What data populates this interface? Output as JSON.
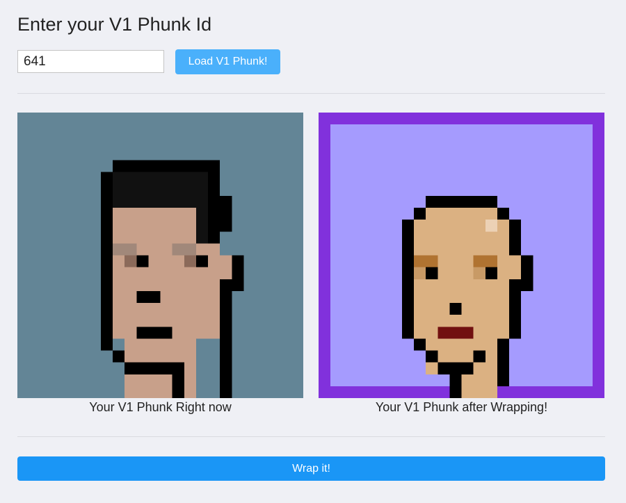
{
  "page": {
    "heading": "Enter your V1 Phunk Id"
  },
  "form": {
    "phunk_id_value": "641",
    "load_button_label": "Load V1 Phunk!"
  },
  "preview": {
    "current_caption": "Your V1 Phunk Right now",
    "wrapped_caption": "Your V1 Phunk after Wrapping!"
  },
  "actions": {
    "wrap_button_label": "Wrap it!"
  },
  "colors": {
    "current_background": "#638596",
    "wrapped_background": "#a59bfe",
    "wrapped_frame": "#8131dc",
    "load_button": "#4ab0fb",
    "wrap_button": "#1a96f6",
    "skin_current": "#c8a08a",
    "skin_wrapped": "#dbb182",
    "lips_wrapped": "#711010"
  }
}
